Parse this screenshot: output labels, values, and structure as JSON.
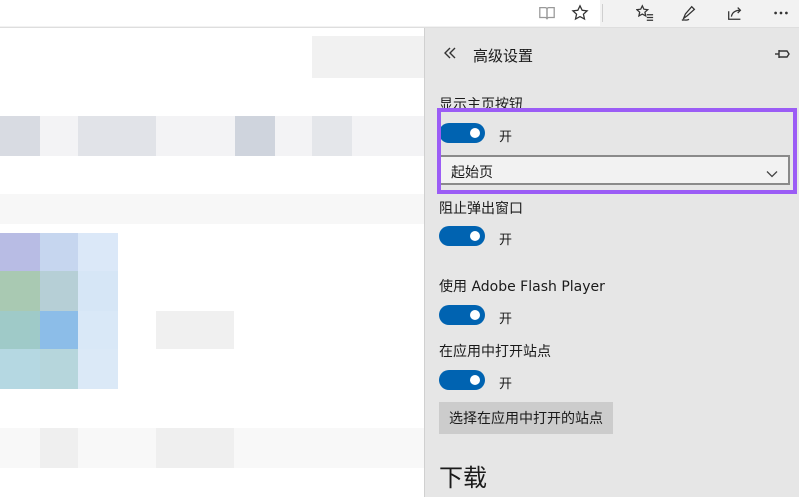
{
  "toolbar": {
    "icons": [
      "reading-view-icon",
      "favorite-star-icon",
      "favorites-hub-icon",
      "pen-icon",
      "share-icon",
      "more-icon"
    ]
  },
  "panel": {
    "title": "高级设置",
    "home_button": {
      "label": "显示主页按钮",
      "toggle_state": "开",
      "select_value": "起始页"
    },
    "popup": {
      "label": "阻止弹出窗口",
      "toggle_state": "开"
    },
    "flash": {
      "label": "使用 Adobe Flash Player",
      "toggle_state": "开"
    },
    "open_in_apps": {
      "label": "在应用中打开站点",
      "toggle_state": "开",
      "button_label": "选择在应用中打开的站点"
    },
    "downloads_heading": "下载"
  },
  "colors": {
    "toggle_on": "#0063b1",
    "highlight": "#9b5cf5",
    "panel_bg": "#e6e6e6"
  }
}
